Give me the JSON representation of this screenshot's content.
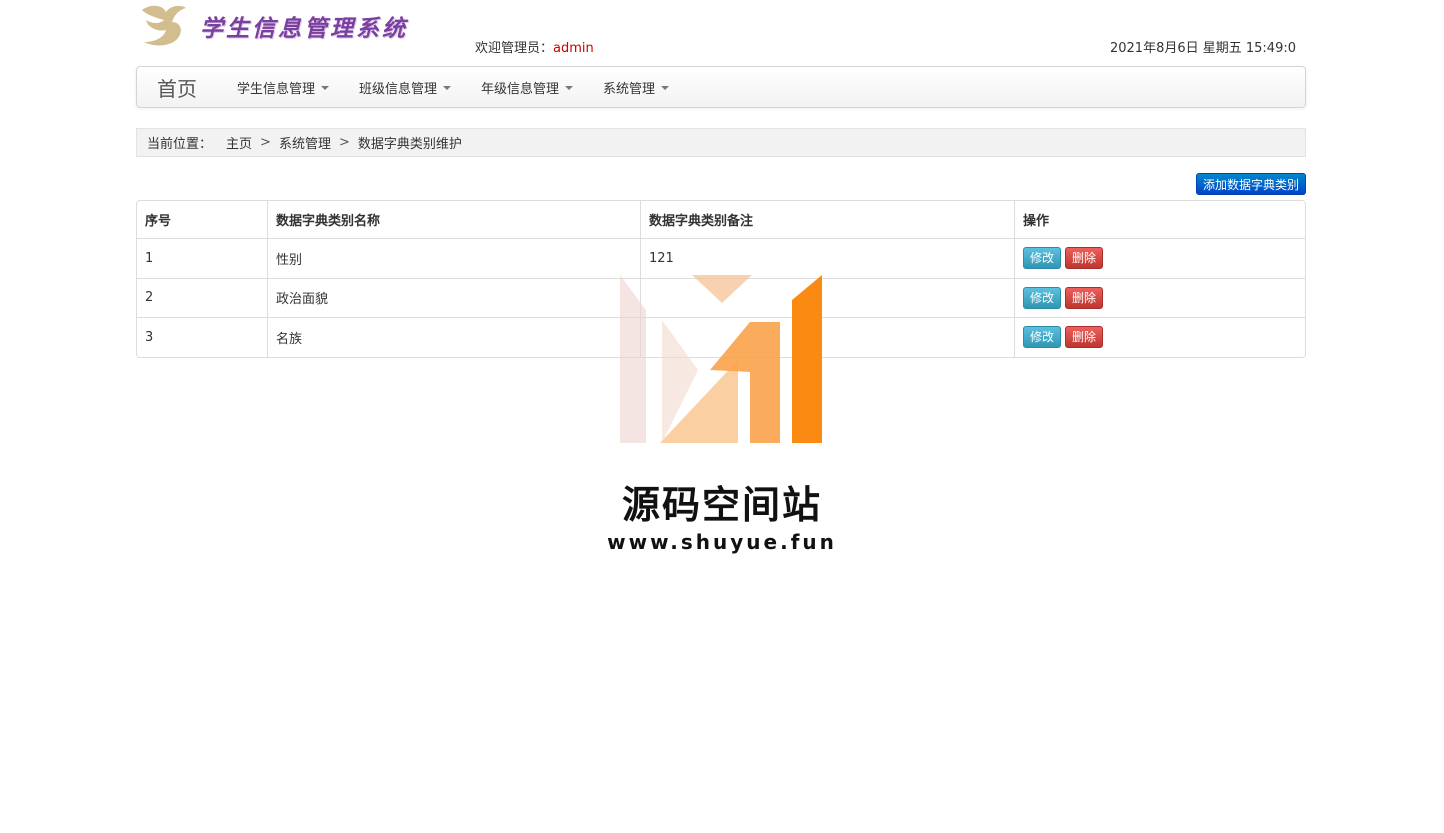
{
  "header": {
    "app_title": "学生信息管理系统",
    "welcome_label": "欢迎管理员：",
    "username": "admin",
    "datetime": "2021年8月6日 星期五 15:49:0"
  },
  "navbar": {
    "brand": "首页",
    "menus": [
      {
        "label": "学生信息管理"
      },
      {
        "label": "班级信息管理"
      },
      {
        "label": "年级信息管理"
      },
      {
        "label": "系统管理"
      }
    ]
  },
  "breadcrumb": {
    "lead": "当前位置：",
    "items": [
      "主页",
      "系统管理",
      "数据字典类别维护"
    ],
    "separator": ">"
  },
  "toolbar": {
    "add_label": "添加数据字典类别"
  },
  "table": {
    "headers": [
      "序号",
      "数据字典类别名称",
      "数据字典类别备注",
      "操作"
    ],
    "rows": [
      {
        "index": "1",
        "name": "性别",
        "remark": "121"
      },
      {
        "index": "2",
        "name": "政治面貌",
        "remark": ""
      },
      {
        "index": "3",
        "name": "名族",
        "remark": ""
      }
    ],
    "edit_label": "修改",
    "delete_label": "删除"
  },
  "watermark": {
    "title": "源码空间站",
    "url": "www.shuyue.fun"
  },
  "colors": {
    "accent_blue": "#0055cc",
    "edit_button": "#49afcd",
    "delete_button": "#da4f49",
    "username_red": "#cc0000"
  }
}
